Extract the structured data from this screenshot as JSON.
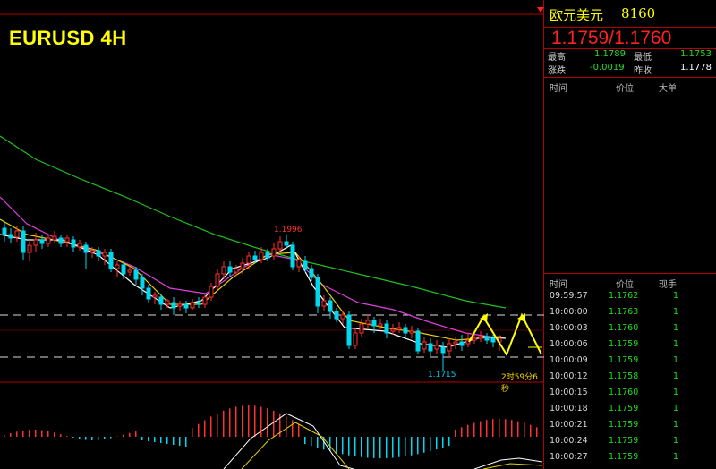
{
  "chart": {
    "symbol_title": "EURUSD 4H",
    "high_label": "1.1996",
    "low_label": "1.1715",
    "countdown": "2时59分6秒"
  },
  "panel": {
    "pair_name": "欧元美元",
    "pair_code": "8160",
    "bid_ask": "1.1759/1.1760",
    "stats": {
      "high_label": "最高",
      "high_value": "1.1789",
      "low_label": "最低",
      "low_value": "1.1753",
      "change_label": "涨跌",
      "change_value": "-0.0019",
      "prev_close_label": "昨收",
      "prev_close_value": "1.1778"
    },
    "big_orders_headers": {
      "time": "时间",
      "price": "价位",
      "volume": "大单"
    },
    "trades_headers": {
      "time": "时间",
      "price": "价位",
      "volume": "现手"
    },
    "trades": [
      {
        "time": "09:59:57",
        "price": "1.1762",
        "volume": "1"
      },
      {
        "time": "10:00:00",
        "price": "1.1763",
        "volume": "1"
      },
      {
        "time": "10:00:03",
        "price": "1.1760",
        "volume": "1"
      },
      {
        "time": "10:00:06",
        "price": "1.1759",
        "volume": "1"
      },
      {
        "time": "10:00:09",
        "price": "1.1759",
        "volume": "1"
      },
      {
        "time": "10:00:12",
        "price": "1.1758",
        "volume": "1"
      },
      {
        "time": "10:00:15",
        "price": "1.1760",
        "volume": "1"
      },
      {
        "time": "10:00:18",
        "price": "1.1759",
        "volume": "1"
      },
      {
        "time": "10:00:21",
        "price": "1.1759",
        "volume": "1"
      },
      {
        "time": "10:00:24",
        "price": "1.1759",
        "volume": "1"
      },
      {
        "time": "10:00:27",
        "price": "1.1759",
        "volume": "1"
      }
    ]
  },
  "colors": {
    "up": "#ff3030",
    "down": "#00d8f0",
    "ma_fast": "#ffffff",
    "ma_mid": "#e6d200",
    "ma_slow": "#e040e0",
    "ma_long": "#20c020",
    "projection": "#ffff00",
    "border": "#b00000"
  }
}
